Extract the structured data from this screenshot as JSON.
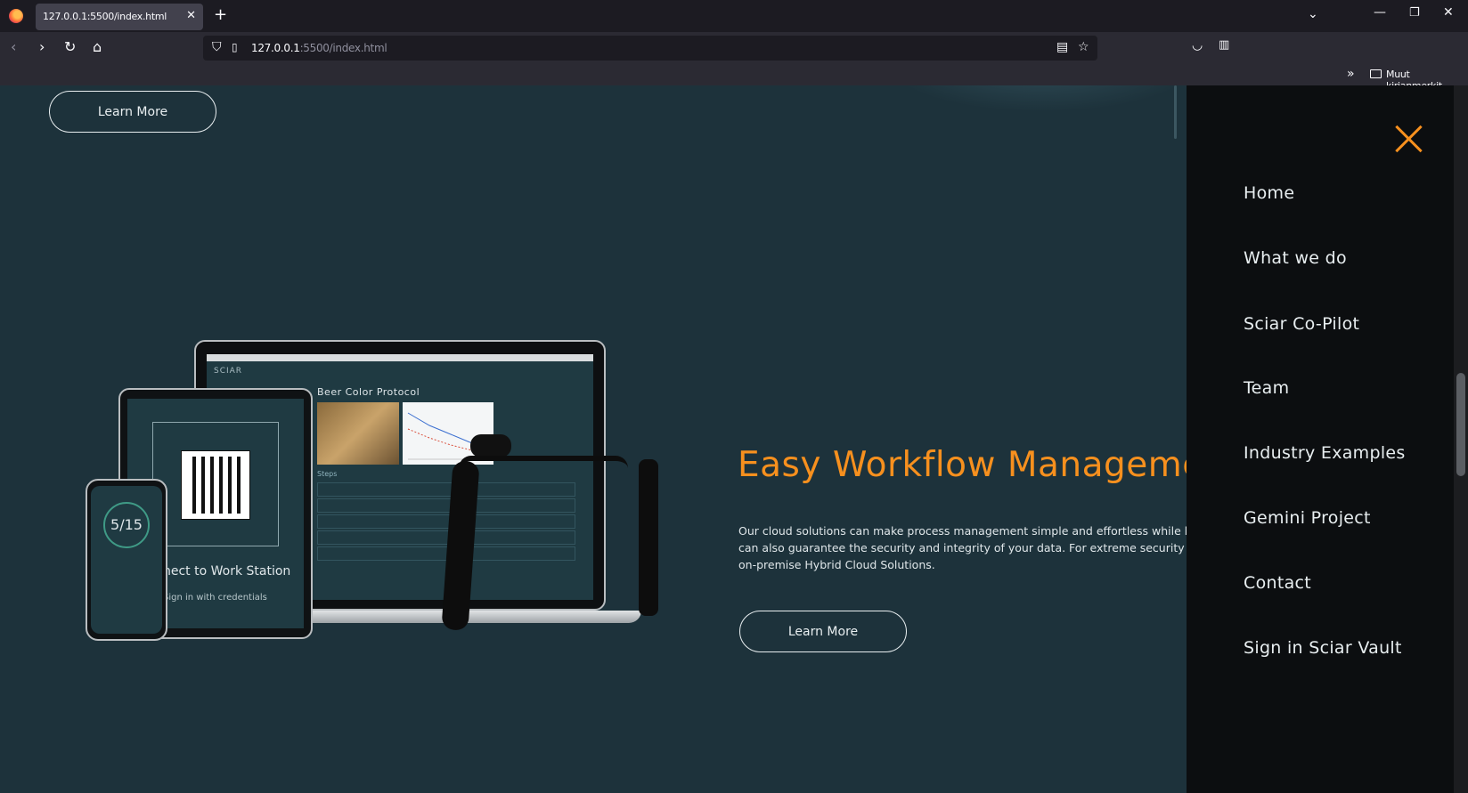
{
  "browser": {
    "tab_title": "127.0.0.1:5500/index.html",
    "url_host": "127.0.0.1",
    "url_rest": ":5500/index.html",
    "bookmark_folder": "Muut kirjanmerkit"
  },
  "page": {
    "top_button": "Learn More",
    "headline": "Easy Workflow Manageme",
    "body": "Our cloud solutions can make process management simple and effortless while k can also guarantee the security and integrity of your data. For extreme security c on-premise Hybrid Cloud Solutions.",
    "main_button": "Learn More",
    "devices": {
      "laptop_brand": "SCIAR",
      "laptop_title": "Beer Color Protocol",
      "laptop_steps_label": "Steps",
      "tablet_text": "nect to Work Station",
      "tablet_sub": "Sign in with credentials",
      "phone_count": "5/15"
    }
  },
  "side_nav": {
    "items": [
      "Home",
      "What we do",
      "Sciar Co-Pilot",
      "Team",
      "Industry Examples",
      "Gemini Project",
      "Contact",
      "Sign in Sciar Vault"
    ]
  },
  "colors": {
    "accent": "#f7901e",
    "page_bg": "#1d323b",
    "nav_bg": "#0c0e10"
  }
}
